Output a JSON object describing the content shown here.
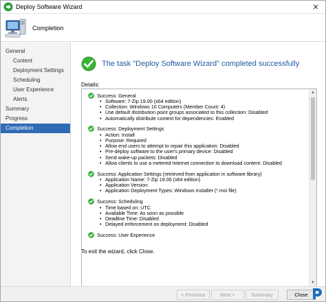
{
  "window": {
    "title": "Deploy Software Wizard",
    "close_glyph": "✕"
  },
  "banner": {
    "title": "Completion",
    "icon": "computer-icon"
  },
  "nav": {
    "items": [
      {
        "label": "General",
        "level": 0,
        "active": false
      },
      {
        "label": "Content",
        "level": 1,
        "active": false
      },
      {
        "label": "Deployment Settings",
        "level": 1,
        "active": false
      },
      {
        "label": "Scheduling",
        "level": 1,
        "active": false
      },
      {
        "label": "User Experience",
        "level": 1,
        "active": false
      },
      {
        "label": "Alerts",
        "level": 1,
        "active": false
      },
      {
        "label": "Summary",
        "level": 0,
        "active": false
      },
      {
        "label": "Progress",
        "level": 0,
        "active": false
      },
      {
        "label": "Completion",
        "level": 0,
        "active": true
      }
    ]
  },
  "main": {
    "headline": "The task \"Deploy Software Wizard\" completed successfully",
    "details_label": "Details:",
    "sections": [
      {
        "title": "Success: General",
        "bullets": [
          "Software: 7-Zip 19.00 (x64 edition)",
          "Collection: Windows 10 Computers (Member Count: 4)",
          "Use default distribution point groups associated to this collection: Disabled",
          "Automatically distribute content for dependencies: Enabled"
        ]
      },
      {
        "title": "Success: Deployment Settings",
        "bullets": [
          "Action: Install",
          "Purpose: Required",
          "Allow end users to attempt to repair this application: Disabled",
          "Pre-deploy software to the user's primary device: Disabled",
          "Send wake-up packets: Disabled",
          "Allow clients to use a metered Internet connection to download content: Disabled"
        ]
      },
      {
        "title": "Success: Application Settings (retrieved from application in software library)",
        "bullets": [
          "Application Name: 7-Zip 19.00 (x64 edition)",
          "Application Version:",
          "Application Deployment Types: Windows Installer (*.msi file)"
        ]
      },
      {
        "title": "Success: Scheduling",
        "bullets": [
          "Time based on: UTC",
          "Available Time: As soon as possible",
          "Deadline Time: Disabled",
          "Delayed enforcement on deployment: Disabled"
        ]
      },
      {
        "title": "Success: User Experience",
        "bullets": []
      }
    ],
    "exit_text": "To exit the wizard, click Close."
  },
  "footer": {
    "previous_label": "< Previous",
    "next_label": "Next >",
    "summary_label": "Summary",
    "close_label": "Close"
  },
  "colors": {
    "accent": "#2f6bb5",
    "headline": "#1e5aa3",
    "success_green": "#2e9e2e"
  }
}
